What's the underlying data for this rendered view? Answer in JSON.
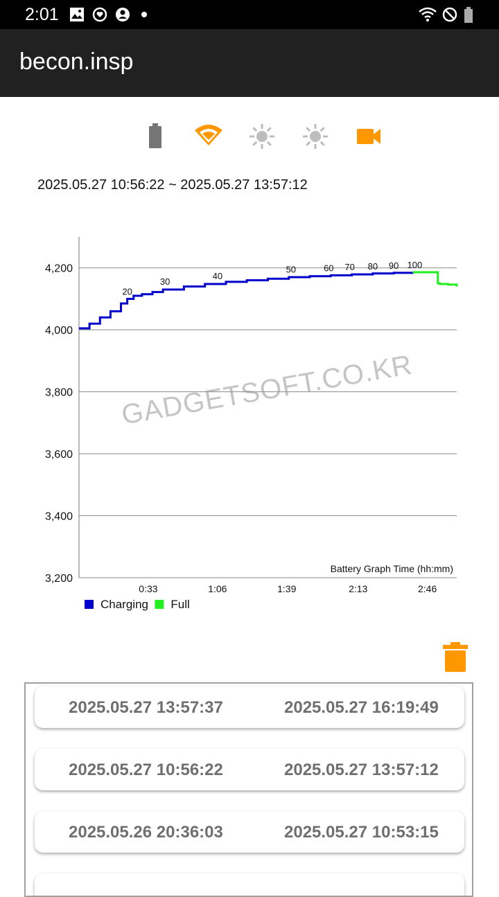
{
  "status_bar": {
    "time": "2:01"
  },
  "app_bar": {
    "title": "becon.insp"
  },
  "toolbar_icons": [
    "battery-icon",
    "wifi-icon",
    "brightness-icon",
    "brightness-icon",
    "videocam-icon"
  ],
  "colors": {
    "accent": "#ff9800",
    "charging": "#0000cc",
    "full": "#22ee22",
    "grid": "#888888"
  },
  "range_text": "2025.05.27 10:56:22 ~ 2025.05.27 13:57:12",
  "watermark": "GADGETSOFT.CO.KR",
  "chart_data": {
    "type": "line",
    "xlabel": "Battery Graph Time (hh:mm)",
    "ylim": [
      3200,
      4300
    ],
    "y_ticks": [
      "4,200",
      "4,000",
      "3,800",
      "3,600",
      "3,400",
      "3,200"
    ],
    "y_tick_values": [
      4200,
      4000,
      3800,
      3600,
      3400,
      3200
    ],
    "xlim": [
      0,
      180
    ],
    "x_ticks": [
      "0:33",
      "1:06",
      "1:39",
      "2:13",
      "2:46"
    ],
    "x_tick_values": [
      33,
      66,
      99,
      133,
      166
    ],
    "grid": true,
    "legend_position": "bottom-left",
    "series": [
      {
        "name": "Charging",
        "color": "#0000cc",
        "x": [
          0,
          5,
          10,
          15,
          20,
          23,
          26,
          30,
          35,
          40,
          50,
          60,
          70,
          80,
          90,
          100,
          110,
          120,
          130,
          140,
          150,
          159
        ],
        "y": [
          4005,
          4020,
          4040,
          4060,
          4085,
          4100,
          4110,
          4115,
          4122,
          4130,
          4140,
          4148,
          4155,
          4160,
          4165,
          4170,
          4173,
          4176,
          4179,
          4182,
          4184,
          4186
        ]
      },
      {
        "name": "Full",
        "color": "#22ee22",
        "x": [
          159,
          165,
          170,
          171,
          172,
          176,
          180
        ],
        "y": [
          4186,
          4186,
          4186,
          4150,
          4148,
          4146,
          4140
        ]
      }
    ],
    "annotations": [
      {
        "text": "20",
        "x": 23,
        "y": 4100
      },
      {
        "text": "30",
        "x": 41,
        "y": 4132
      },
      {
        "text": "40",
        "x": 66,
        "y": 4150
      },
      {
        "text": "50",
        "x": 101,
        "y": 4171
      },
      {
        "text": "60",
        "x": 119,
        "y": 4176
      },
      {
        "text": "70",
        "x": 129,
        "y": 4179
      },
      {
        "text": "80",
        "x": 140,
        "y": 4182
      },
      {
        "text": "90",
        "x": 150,
        "y": 4184
      },
      {
        "text": "100",
        "x": 160,
        "y": 4186
      }
    ]
  },
  "history": [
    {
      "start": "2025.05.27 13:57:37",
      "end": "2025.05.27 16:19:49"
    },
    {
      "start": "2025.05.27 10:56:22",
      "end": "2025.05.27 13:57:12"
    },
    {
      "start": "2025.05.26 20:36:03",
      "end": "2025.05.27 10:53:15"
    }
  ]
}
